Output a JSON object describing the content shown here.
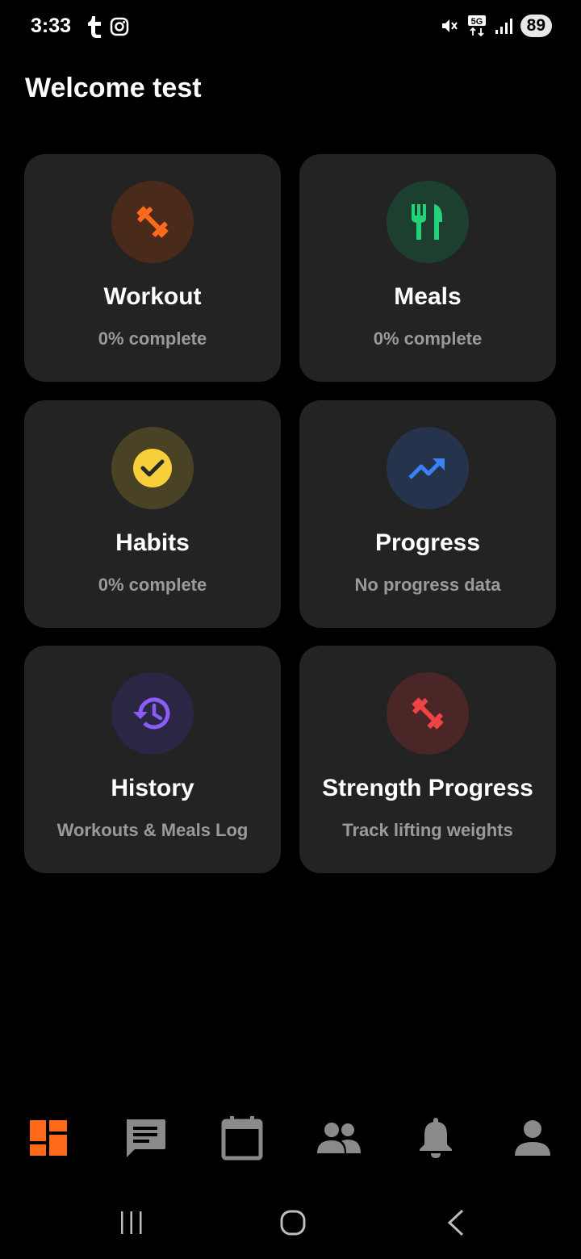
{
  "status_bar": {
    "time": "3:33",
    "battery": "89",
    "network": "5G"
  },
  "welcome_text": "Welcome test",
  "cards": {
    "workout": {
      "title": "Workout",
      "subtitle": "0% complete",
      "icon": "dumbbell-icon",
      "color": "#ff6a1a",
      "bg": "#4a2a1a"
    },
    "meals": {
      "title": "Meals",
      "subtitle": "0% complete",
      "icon": "utensils-icon",
      "color": "#22d37a",
      "bg": "#1d3f2f"
    },
    "habits": {
      "title": "Habits",
      "subtitle": "0% complete",
      "icon": "check-circle-icon",
      "color": "#f7cf3a",
      "bg": "#4a4224"
    },
    "progress": {
      "title": "Progress",
      "subtitle": "No progress data",
      "icon": "trending-up-icon",
      "color": "#3b82f6",
      "bg": "#26334d"
    },
    "history": {
      "title": "History",
      "subtitle": "Workouts & Meals Log",
      "icon": "history-icon",
      "color": "#8b5cf6",
      "bg": "#2c2645"
    },
    "strength": {
      "title": "Strength Progress",
      "subtitle": "Track lifting weights",
      "icon": "dumbbell-icon",
      "color": "#ef4444",
      "bg": "#4a2626"
    }
  },
  "bottom_nav": {
    "active": "dashboard",
    "accent": "#ff6a1a",
    "inactive_color": "#8a8a8a",
    "items": [
      "dashboard-icon",
      "chat-icon",
      "calendar-icon",
      "people-icon",
      "bell-icon",
      "person-icon"
    ]
  }
}
